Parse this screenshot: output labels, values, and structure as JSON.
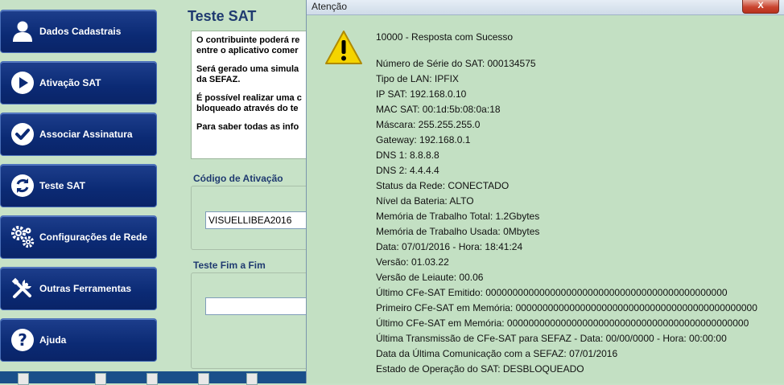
{
  "sidebar": {
    "items": [
      {
        "label": "Dados Cadastrais",
        "icon": "user-icon"
      },
      {
        "label": "Ativação SAT",
        "icon": "play-icon"
      },
      {
        "label": "Associar Assinatura",
        "icon": "checkmark-icon"
      },
      {
        "label": "Teste SAT",
        "icon": "refresh-icon"
      },
      {
        "label": "Configurações de Rede",
        "icon": "gears-icon"
      },
      {
        "label": "Outras Ferramentas",
        "icon": "tools-icon"
      },
      {
        "label": "Ajuda",
        "icon": "help-icon"
      }
    ]
  },
  "main": {
    "title": "Teste SAT",
    "info_lines": [
      [
        "O contribuinte poderá re",
        "entre o aplicativo comer"
      ],
      [
        "Será gerado uma simula",
        "da SEFAZ."
      ],
      [
        "É possível realizar uma c",
        "bloqueado através do te"
      ],
      [
        "Para saber todas as info"
      ]
    ],
    "codigo_label": "Código de Ativação",
    "codigo_value": "VISUELLIBEA2016",
    "teste_label": "Teste Fim a Fim",
    "teste_value": ""
  },
  "dialog": {
    "title": "Atenção",
    "close_label": "X",
    "lines": [
      "10000 - Resposta com Sucesso",
      "Número de Série do SAT: 000134575",
      "Tipo de LAN: IPFIX",
      "IP SAT: 192.168.0.10",
      "MAC SAT: 00:1d:5b:08:0a:18",
      "Máscara: 255.255.255.0",
      "Gateway: 192.168.0.1",
      "DNS 1: 8.8.8.8",
      "DNS 2: 4.4.4.4",
      "Status da Rede: CONECTADO",
      "Nível da Bateria: ALTO",
      "Memória de Trabalho Total: 1.2Gbytes",
      "Memória de Trabalho Usada: 0Mbytes",
      "Data: 07/01/2016 - Hora: 18:41:24",
      "Versão: 01.03.22",
      "Versão de Leiaute: 00.06",
      "Último CFe-SAT Emitido: 000000000000000000000000000000000000000000000",
      "Primeiro CFe-SAT em Memória: 000000000000000000000000000000000000000000000",
      "Último CFe-SAT em Memória: 000000000000000000000000000000000000000000000",
      "Última Transmissão de CFe-SAT para SEFAZ - Data: 00/00/0000 - Hora: 00:00:00",
      "Data da Última Comunicação com a SEFAZ: 07/01/2016",
      "Estado de Operação do SAT: DESBLOQUEADO"
    ]
  },
  "colors": {
    "background": "#c7e2c7",
    "button": "#0b2a74",
    "title_text": "#1f3a70"
  }
}
